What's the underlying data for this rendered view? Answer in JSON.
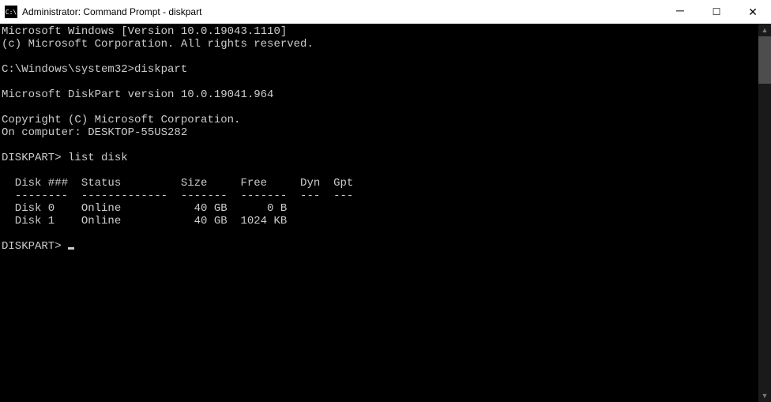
{
  "titlebar": {
    "icon_text": "C:\\",
    "title": "Administrator: Command Prompt - diskpart",
    "min_label": "─",
    "max_label": "☐",
    "close_label": "✕"
  },
  "terminal": {
    "line_os_version": "Microsoft Windows [Version 10.0.19043.1110]",
    "line_copyright_os": "(c) Microsoft Corporation. All rights reserved.",
    "blank": "",
    "line_prompt_cmd": "C:\\Windows\\system32>diskpart",
    "line_dp_version": "Microsoft DiskPart version 10.0.19041.964",
    "line_dp_copyright": "Copyright (C) Microsoft Corporation.",
    "line_computer": "On computer: DESKTOP-55US282",
    "line_prompt_listdisk": "DISKPART> list disk",
    "line_header": "  Disk ###  Status         Size     Free     Dyn  Gpt",
    "line_divider": "  --------  -------------  -------  -------  ---  ---",
    "line_disk0": "  Disk 0    Online           40 GB      0 B",
    "line_disk1": "  Disk 1    Online           40 GB  1024 KB",
    "line_prompt_end": "DISKPART> "
  },
  "scroll": {
    "up": "▲",
    "down": "▼"
  }
}
